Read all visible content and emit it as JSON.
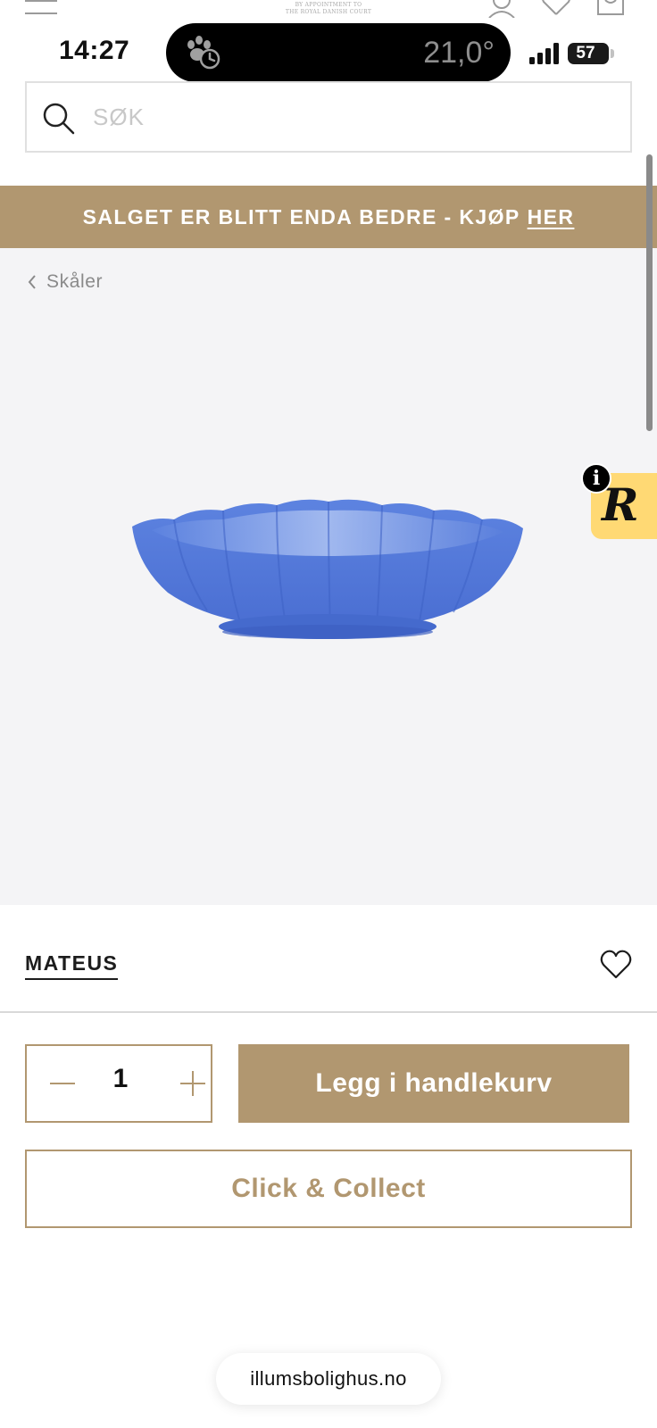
{
  "site_header": {
    "royal_warrant_line1": "BY APPOINTMENT TO",
    "royal_warrant_line2": "THE ROYAL DANISH COURT",
    "icons": [
      "menu-icon",
      "account-icon",
      "heart-icon",
      "cart-icon"
    ]
  },
  "status_bar": {
    "time": "14:27",
    "temperature": "21,0°",
    "battery": "57",
    "icons": [
      "pawprint-timer-icon",
      "cellular-signal-icon",
      "battery-icon"
    ]
  },
  "search": {
    "placeholder": "SØK",
    "value": ""
  },
  "promo_banner": {
    "text": "SALGET ER BLITT ENDA BEDRE - KJØP",
    "link_label": "HER",
    "background": "#b19770"
  },
  "breadcrumb": {
    "label": "Skåler"
  },
  "widget": {
    "letter": "R",
    "info_label": "i",
    "background": "#ffd974"
  },
  "product": {
    "brand": "MATEUS",
    "quantity": "1",
    "add_to_cart_label": "Legg i handlekurv",
    "click_collect_label": "Click & Collect",
    "bowl_color": "#4f76d8"
  },
  "browser": {
    "url": "illumsbolighus.no"
  },
  "colors": {
    "accent": "#b19770",
    "gallery_background": "#f4f4f6",
    "text": "#1c1c1c"
  }
}
